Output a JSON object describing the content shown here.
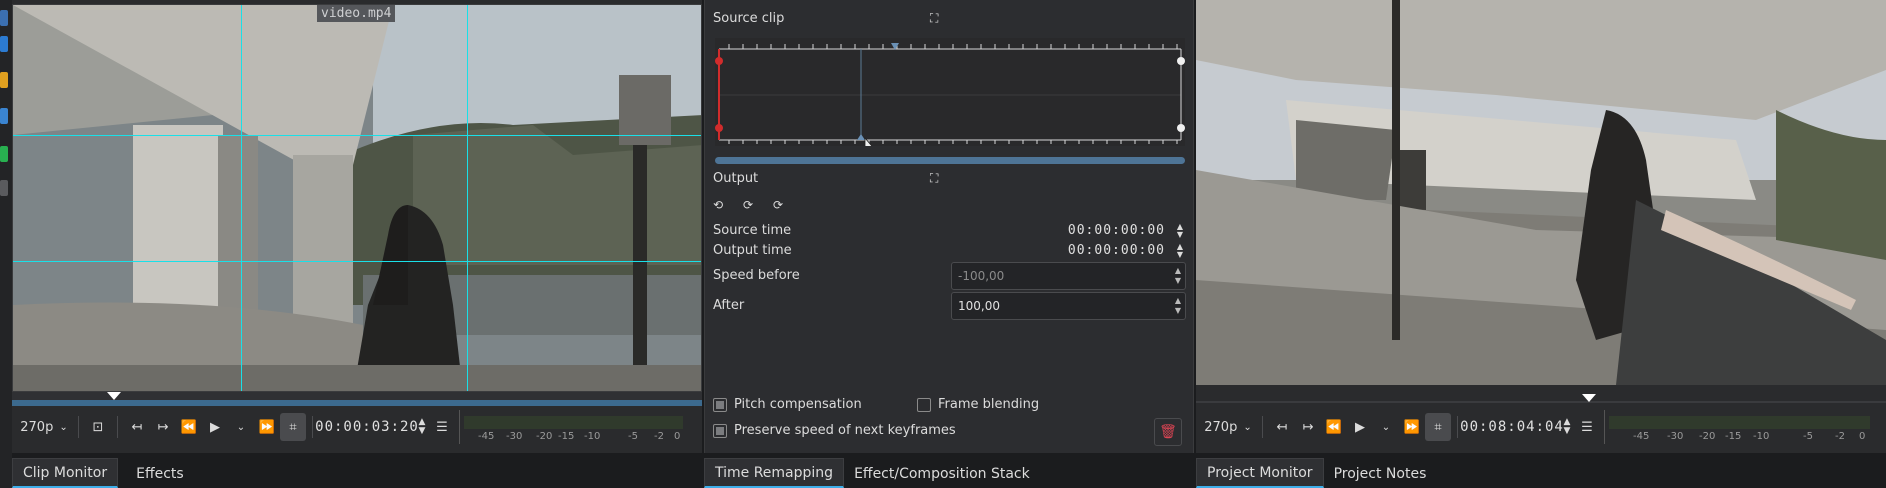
{
  "clip_monitor": {
    "filename_overlay": "video.mp4",
    "resolution": "270p",
    "timecode": "00:00:03:20",
    "audio_scale": [
      "-45",
      "-30",
      "-20",
      "-15",
      "-10",
      "-5",
      "-2",
      "0"
    ]
  },
  "time_remapping": {
    "source_clip_label": "Source clip",
    "output_label": "Output",
    "source_time_label": "Source time",
    "source_time_value": "00:00:00:00",
    "output_time_label": "Output time",
    "output_time_value": "00:00:00:00",
    "speed_before_label": "Speed before",
    "speed_before_value": "-100,00",
    "after_label": "After",
    "after_value": "100,00",
    "pitch_compensation_label": "Pitch compensation",
    "frame_blending_label": "Frame blending",
    "preserve_speed_label": "Preserve speed of next keyframes"
  },
  "project_monitor": {
    "resolution": "270p",
    "timecode": "00:08:04:04",
    "audio_scale": [
      "-45",
      "-30",
      "-20",
      "-15",
      "-10",
      "-5",
      "-2",
      "0"
    ]
  },
  "tabs": {
    "clip_monitor": "Clip Monitor",
    "effects": "Effects",
    "time_remapping": "Time Remapping",
    "effect_stack": "Effect/Composition Stack",
    "project_monitor": "Project Monitor",
    "project_notes": "Project Notes"
  },
  "icons": {
    "play": "play-icon",
    "rewind": "rewind-icon",
    "forward": "fast-forward-icon",
    "menu": "hamburger-icon",
    "crop": "crop-icon",
    "delete": "trash-icon",
    "lock": "lock-icon"
  },
  "colors": {
    "accent": "#3daee9",
    "guide": "#19e0e8",
    "keyframe_red": "#d12c2c",
    "delete_red": "#da4453"
  }
}
